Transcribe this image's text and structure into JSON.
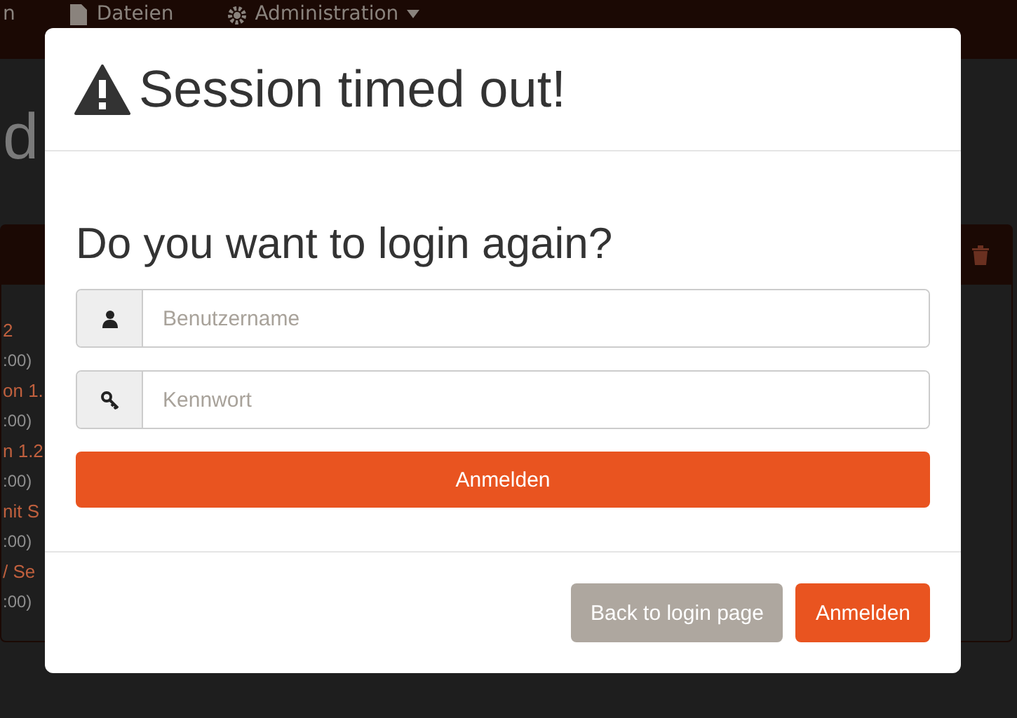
{
  "background": {
    "nav_items": [
      {
        "label": "n",
        "kind": "plain",
        "dropdown": false
      },
      {
        "label": "Dateien",
        "kind": "file",
        "dropdown": false
      },
      {
        "label": "Administration",
        "kind": "gear",
        "dropdown": true
      }
    ],
    "heading": "d",
    "panel": {
      "rows": [
        {
          "name": "2",
          "time": ":00)"
        },
        {
          "name": "on 1.",
          "time": ":00)"
        },
        {
          "name": "n 1.2",
          "time": ":00)"
        },
        {
          "name": "nit S",
          "time": ":00)"
        },
        {
          "name": "/ Se",
          "time": ":00)"
        }
      ]
    }
  },
  "modal": {
    "title": "Session timed out!",
    "question": "Do you want to login again?",
    "fields": [
      {
        "kind": "user",
        "placeholder": "Benutzername"
      },
      {
        "kind": "password",
        "placeholder": "Kennwort"
      }
    ],
    "submit": "Anmelden",
    "footer_buttons": [
      {
        "label": "Back to login page",
        "kind": "secondary"
      },
      {
        "label": "Anmelden",
        "kind": "primary"
      }
    ]
  }
}
